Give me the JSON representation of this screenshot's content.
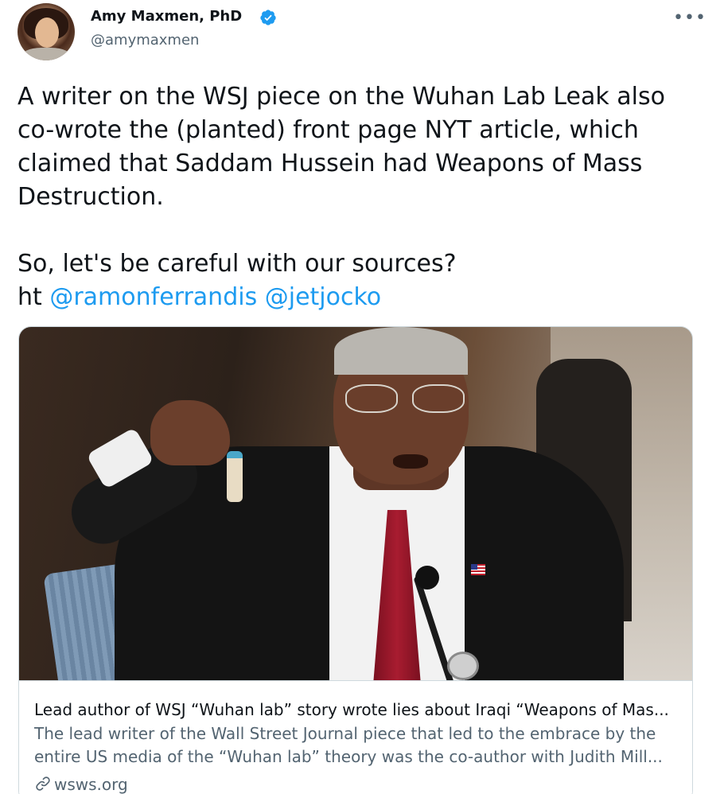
{
  "author": {
    "display_name": "Amy Maxmen, PhD",
    "handle": "@amymaxmen",
    "verified_icon": "verified-badge-icon"
  },
  "menu": {
    "more_icon": "more-options-icon",
    "more_glyph": "•••"
  },
  "tweet": {
    "lines": [
      "A writer on the WSJ piece on the Wuhan Lab Leak also",
      "co-wrote the (planted) front page NYT article, which",
      "claimed that Saddam Hussein had Weapons of Mass",
      "Destruction."
    ],
    "question": "So, let's be careful with our sources?",
    "ht_prefix": "ht",
    "mentions": [
      "@ramonferrandis",
      "@jetjocko"
    ]
  },
  "link_card": {
    "image_alt": "Colin Powell holding a vial at the UN Security Council",
    "title": "Lead author of WSJ “Wuhan lab” story wrote lies about Iraqi “Weapons of Mas...",
    "description_lines": [
      "The lead writer of the Wall Street Journal piece that led to the embrace by the",
      "entire US media of the “Wuhan lab” theory was the co-author with Judith Mill..."
    ],
    "domain": "wsws.org",
    "domain_icon": "link-icon"
  },
  "colors": {
    "text": "#0f1419",
    "secondary": "#536471",
    "link": "#1d9bf0",
    "border": "#cfd9de",
    "verified": "#1d9bf0"
  }
}
